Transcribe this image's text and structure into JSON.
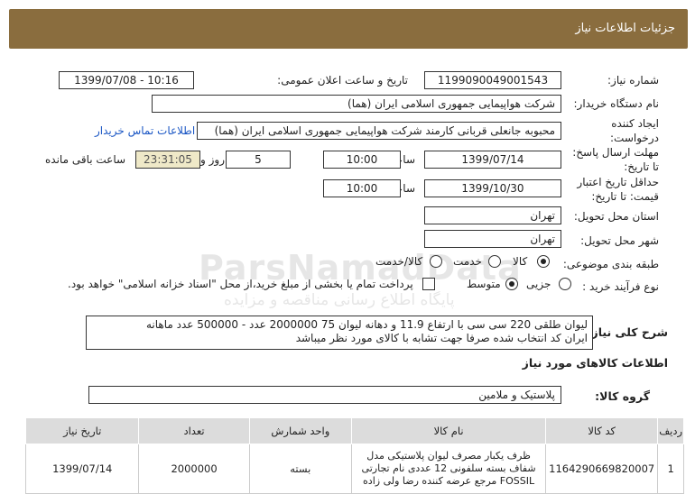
{
  "header": {
    "title": "جزئیات اطلاعات نیاز"
  },
  "form": {
    "need_number": {
      "label": "شماره نیاز:",
      "value": "1199090049001543"
    },
    "announce_datetime": {
      "label": "تاریخ و ساعت اعلان عمومی:",
      "value": "1399/07/08 - 10:16"
    },
    "buyer_org": {
      "label": "نام دستگاه خریدار:",
      "value": "شرکت هواپیمایی جمهوری اسلامی ایران (هما)"
    },
    "requester": {
      "label_line1": "ایجاد کننده",
      "label_line2": "درخواست:",
      "value": "محبوبه جانعلی قربانی کارمند شرکت هواپیمایی جمهوری اسلامی ایران (هما)",
      "contact_link": "اطلاعات تماس خریدار"
    },
    "deadline": {
      "label_line1": "مهلت ارسال پاسخ:",
      "label_line2": "تا تاریخ:",
      "date": "1399/07/14",
      "time_label": "ساعت",
      "time": "10:00",
      "days": "5",
      "days_label": "روز و",
      "remaining_time": "23:31:05",
      "remaining_label": "ساعت باقی مانده"
    },
    "validity": {
      "label_line1": "حداقل تاریخ اعتبار",
      "label_line2": "قیمت: تا تاریخ:",
      "date": "1399/10/30",
      "time_label": "ساعت",
      "time": "10:00"
    },
    "province": {
      "label": "استان محل تحویل:",
      "value": "تهران"
    },
    "city": {
      "label": "شهر محل تحویل:",
      "value": "تهران"
    },
    "category": {
      "label": "طبقه بندی موضوعی:",
      "options": [
        "کالا",
        "خدمت",
        "کالا/خدمت"
      ],
      "selected": "کالا"
    },
    "process": {
      "label": "نوع فرآیند خرید :",
      "options": [
        "جزیی",
        "متوسط"
      ],
      "selected": "متوسط",
      "payment_note": "پرداخت تمام یا بخشی از مبلغ خرید،از محل \"اسناد خزانه اسلامی\" خواهد بود."
    }
  },
  "description": {
    "label": "شرح کلی نیاز:",
    "line1": "لیوان طلقی 220 سی سی با ارتفاع 11.9 و دهانه لیوان 75  2000000 عدد - 500000 عدد ماهانه",
    "line2": "ایران کد انتخاب شده صرفا جهت تشابه با کالای مورد نظر میباشد"
  },
  "goods_section": {
    "title": "اطلاعات کالاهای مورد نیاز",
    "group_label": "گروه کالا:",
    "group_value": "پلاستیک و ملامین"
  },
  "goods_table": {
    "headers": [
      "ردیف",
      "کد کالا",
      "نام کالا",
      "واحد شمارش",
      "تعداد",
      "تاریخ نیاز"
    ],
    "rows": [
      {
        "row": "1",
        "code": "1164290669820007",
        "name": "ظرف یکبار مصرف لیوان پلاستیکی مدل شفاف بسته سلفونی 12 عددی نام تجارتی FOSSIL مرجع عرضه کننده رضا ولی زاده",
        "unit": "بسته",
        "qty": "2000000",
        "date": "1399/07/14"
      }
    ]
  },
  "watermark": {
    "line1": "ParsNamadData",
    "line2": "پایگاه اطلاع رسانی مناقصه و مزایده",
    "line3": "۰۲۱-۸۸۳۴۹۶۷۰-۵"
  }
}
